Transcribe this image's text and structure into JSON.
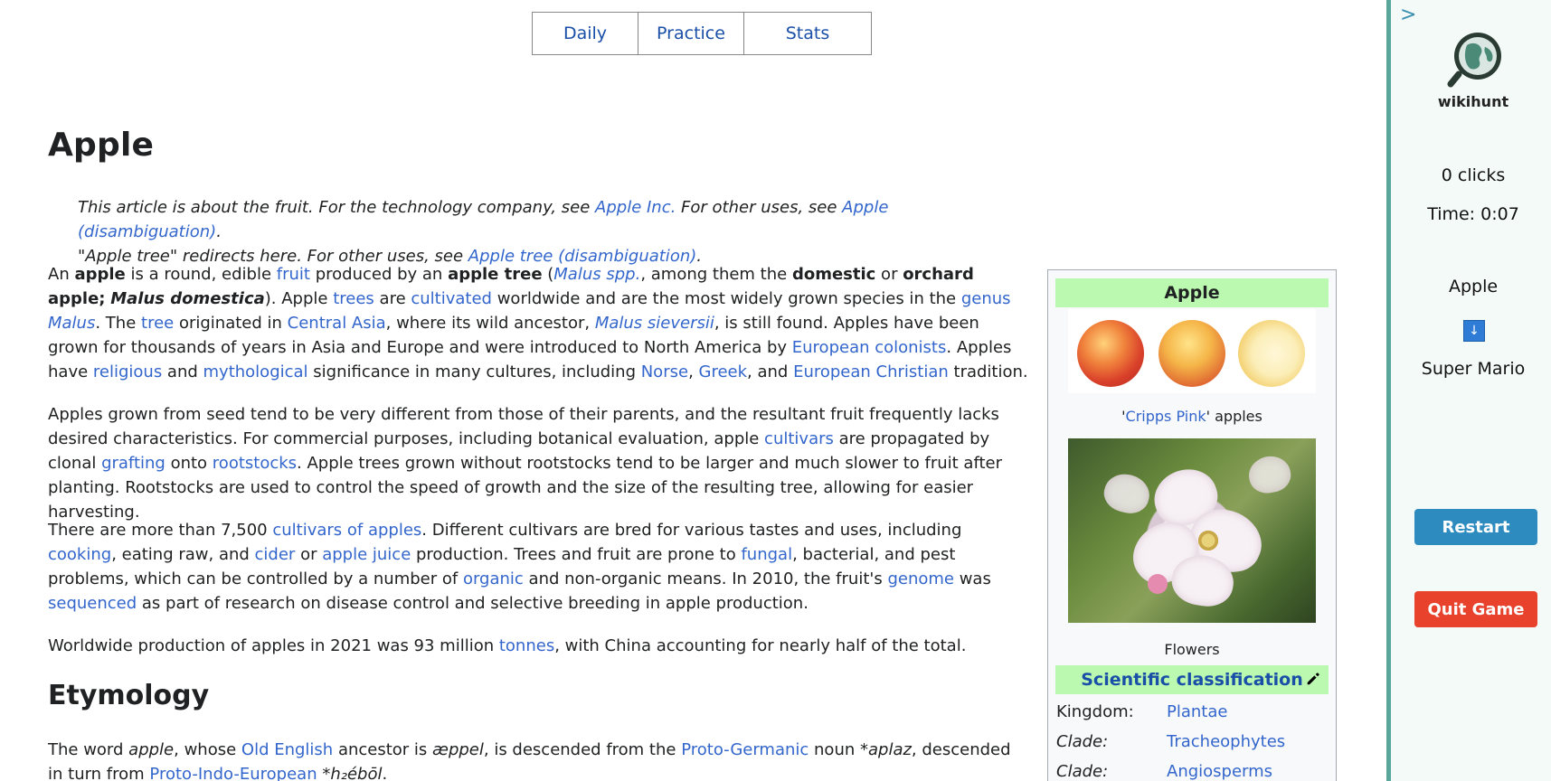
{
  "nav": {
    "tabs": [
      "Daily",
      "Practice",
      "Stats"
    ]
  },
  "article": {
    "title": "Apple",
    "hatnote": {
      "line1_pre": "This article is about the fruit. For the technology company, see ",
      "line1_link1": "Apple Inc.",
      "line1_mid": " For other uses, see ",
      "line1_link2": "Apple (disambiguation)",
      "line1_end": ".",
      "line2_pre": "\"Apple tree\" redirects here. For other uses, see ",
      "line2_link": "Apple tree (disambiguation)",
      "line2_end": "."
    },
    "p1": {
      "t1": "An ",
      "b1": "apple",
      "t2": " is a round, edible ",
      "l1": "fruit",
      "t3": " produced by an ",
      "b2": "apple tree",
      "t4": " (",
      "l2": "Malus spp.",
      "t5": ", among them the ",
      "b3": "domestic",
      "t6": " or ",
      "b4": "orchard apple;",
      "t7": " ",
      "b5": "Malus domestica",
      "t8": "). Apple ",
      "l3": "trees",
      "t9": " are ",
      "l4": "cultivated",
      "t10": " worldwide and are the most widely grown species in the ",
      "l5": "genus",
      "t11": " ",
      "l6": "Malus",
      "t12": ". The ",
      "l7": "tree",
      "t13": " originated in ",
      "l8": "Central Asia",
      "t14": ", where its wild ancestor, ",
      "l9": "Malus sieversii",
      "t15": ", is still found. Apples have been grown for thousands of years in Asia and Europe and were introduced to North America by ",
      "l10": "European colonists",
      "t16": ". Apples have ",
      "l11": "religious",
      "t17": " and ",
      "l12": "mythological",
      "t18": " significance in many cultures, including ",
      "l13": "Norse",
      "t19": ", ",
      "l14": "Greek",
      "t20": ", and ",
      "l15": "European Christian",
      "t21": " tradition."
    },
    "p2": {
      "t1": "Apples grown from seed tend to be very different from those of their parents, and the resultant fruit frequently lacks desired characteristics. For commercial purposes, including botanical evaluation, apple ",
      "l1": "cultivars",
      "t2": " are propagated by clonal ",
      "l2": "grafting",
      "t3": " onto ",
      "l3": "rootstocks",
      "t4": ". Apple trees grown without rootstocks tend to be larger and much slower to fruit after planting. Rootstocks are used to control the speed of growth and the size of the resulting tree, allowing for easier harvesting."
    },
    "p3": {
      "t1": "There are more than 7,500 ",
      "l1": "cultivars of apples",
      "t2": ". Different cultivars are bred for various tastes and uses, including ",
      "l2": "cooking",
      "t3": ", eating raw, and ",
      "l3": "cider",
      "t4": " or ",
      "l4": "apple juice",
      "t5": " production. Trees and fruit are prone to ",
      "l5": "fungal",
      "t6": ", bacterial, and pest problems, which can be controlled by a number of ",
      "l6": "organic",
      "t7": " and non-organic means. In 2010, the fruit's ",
      "l7": "genome",
      "t8": " was ",
      "l8": "sequenced",
      "t9": " as part of research on disease control and selective breeding in apple production."
    },
    "p4": {
      "t1": "Worldwide production of apples in 2021 was 93 million ",
      "l1": "tonnes",
      "t2": ", with China accounting for nearly half of the total."
    },
    "h2": "Etymology",
    "p5": {
      "t1": "The word ",
      "i1": "apple",
      "t2": ", whose ",
      "l1": "Old English",
      "t3": " ancestor is ",
      "i2": "æppel",
      "t4": ", is descended from the ",
      "l2": "Proto-Germanic",
      "t5": " noun *",
      "i3": "aplaz",
      "t6": ", descended in turn from ",
      "l3": "Proto-Indo-European",
      "t7": " *",
      "i4": "h₂ébōl",
      "t8": "."
    }
  },
  "infobox": {
    "title": "Apple",
    "caption1_link": "Cripps Pink",
    "caption1_q1": "'",
    "caption1_q2": "'",
    "caption1_rest": " apples",
    "caption2": "Flowers",
    "sci_title": "Scientific classification",
    "rows": [
      {
        "k": "Kingdom:",
        "v": "Plantae"
      },
      {
        "k": "Clade:",
        "v": "Tracheophytes"
      },
      {
        "k": "Clade:",
        "v": "Angiosperms"
      }
    ]
  },
  "sidebar": {
    "toggle": ">",
    "brand": "wikihunt",
    "clicks": "0 clicks",
    "time": "Time: 0:07",
    "start": "Apple",
    "arrow": "↓",
    "target": "Super Mario",
    "restart": "Restart",
    "quit": "Quit Game"
  },
  "colors": {
    "accent_green": "#bbf8b0",
    "link": "#3366cc",
    "restart": "#2e8bc0",
    "quit": "#e8412c",
    "sidebar_border": "#5aa69a"
  }
}
